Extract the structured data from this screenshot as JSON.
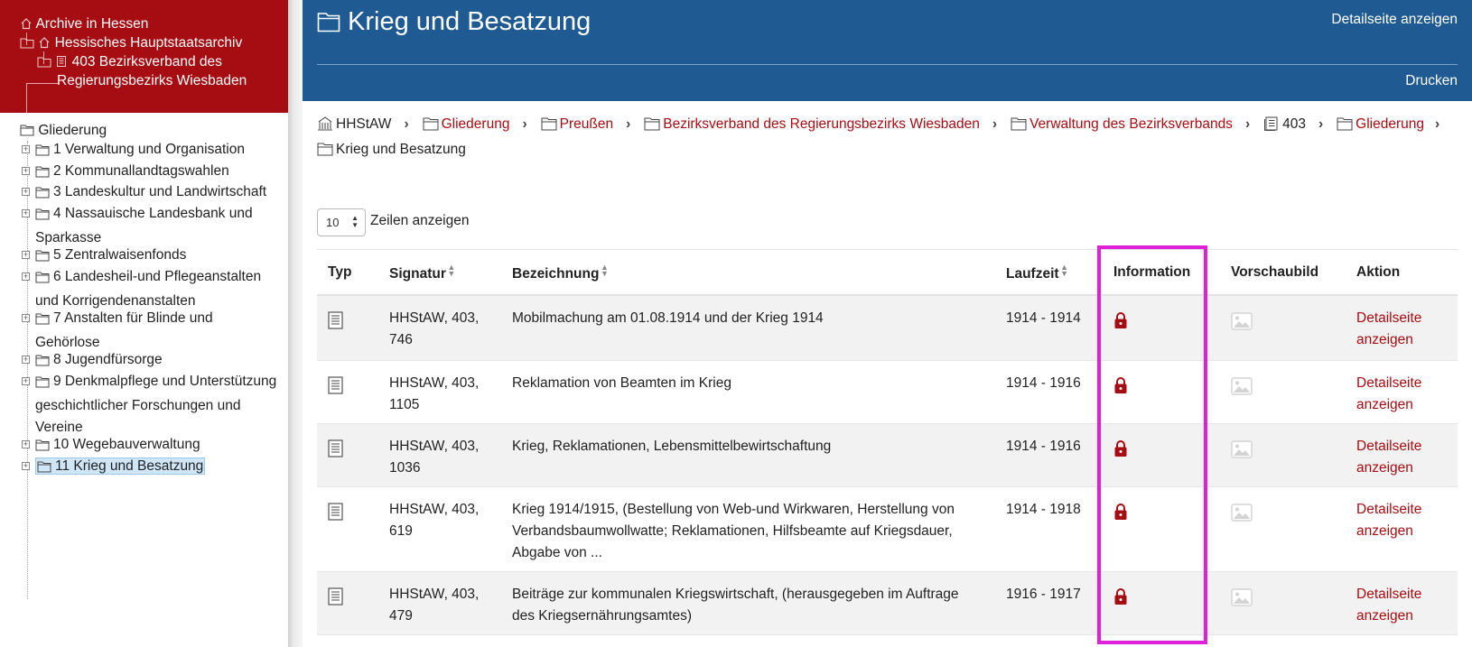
{
  "sidebar": {
    "top": {
      "archive": "Archive in Hessen",
      "haupt": "Hessisches Hauptstaatsarchiv",
      "bestand_line1": "403 Bezirksverband des",
      "bestand_line2": "Regierungsbezirks Wiesbaden"
    },
    "tree_root": "Gliederung",
    "tree_items": [
      {
        "label": "1 Verwaltung und Organisation"
      },
      {
        "label": "2 Kommunallandtagswahlen"
      },
      {
        "label": "3 Landeskultur und Landwirtschaft"
      },
      {
        "label": "4 Nassauische Landesbank und Sparkasse"
      },
      {
        "label": "5 Zentralwaisenfonds"
      },
      {
        "label": "6 Landesheil-und Pflegeanstalten und Korrigendenanstalten"
      },
      {
        "label": "7 Anstalten für Blinde und Gehörlose"
      },
      {
        "label": "8 Jugendfürsorge"
      },
      {
        "label": "9 Denkmalpflege und Unterstützung geschichtlicher Forschungen und Vereine"
      },
      {
        "label": "10 Wegebauverwaltung"
      },
      {
        "label": "11 Krieg und Besatzung"
      }
    ]
  },
  "header": {
    "title": "Krieg und Besatzung",
    "detail_link": "Detailseite anzeigen",
    "print_link": "Drucken"
  },
  "breadcrumb": [
    {
      "label": "HHStAW",
      "icon": "building-icon",
      "link": false
    },
    {
      "label": "Gliederung",
      "icon": "folder-icon",
      "link": true
    },
    {
      "label": "Preußen",
      "icon": "folder-icon",
      "link": true
    },
    {
      "label": "Bezirksverband des Regierungsbezirks Wiesbaden",
      "icon": "folder-icon",
      "link": true
    },
    {
      "label": "Verwaltung des Bezirksverbands",
      "icon": "folder-icon",
      "link": true
    },
    {
      "label": "403",
      "icon": "book-icon",
      "link": false
    },
    {
      "label": "Gliederung",
      "icon": "folder-icon",
      "link": true
    },
    {
      "label": "Krieg und Besatzung",
      "icon": "folder-icon",
      "link": false
    }
  ],
  "rows_select": {
    "value": "10",
    "label": "Zeilen anzeigen"
  },
  "table": {
    "headers": {
      "typ": "Typ",
      "signatur": "Signatur",
      "bezeichnung": "Bezeichnung",
      "laufzeit": "Laufzeit",
      "information": "Information",
      "vorschaubild": "Vorschaubild",
      "aktion": "Aktion"
    },
    "rows": [
      {
        "signatur": "HHStAW, 403, 746",
        "bezeichnung": "Mobilmachung am 01.08.1914 und der Krieg 1914",
        "laufzeit": "1914 - 1914",
        "aktion": "Detailseite anzeigen"
      },
      {
        "signatur": "HHStAW, 403, 1105",
        "bezeichnung": "Reklamation von Beamten im Krieg",
        "laufzeit": "1914 - 1916",
        "aktion": "Detailseite anzeigen"
      },
      {
        "signatur": "HHStAW, 403, 1036",
        "bezeichnung": "Krieg, Reklamationen, Lebensmittelbewirtschaftung",
        "laufzeit": "1914 - 1916",
        "aktion": "Detailseite anzeigen"
      },
      {
        "signatur": "HHStAW, 403, 619",
        "bezeichnung": "Krieg 1914/1915, (Bestellung von Web-und Wirkwaren, Herstellung von Verbandsbaumwollwatte; Reklamationen, Hilfsbeamte auf Kriegsdauer, Abgabe von ...",
        "laufzeit": "1914 - 1918",
        "aktion": "Detailseite anzeigen"
      },
      {
        "signatur": "HHStAW, 403, 479",
        "bezeichnung": "Beiträge zur kommunalen Kriegswirtschaft, (herausgegeben im Auftrage des Kriegsernährungsamtes)",
        "laufzeit": "1916 - 1917",
        "aktion": "Detailseite anzeigen"
      }
    ]
  },
  "colors": {
    "brand_red": "#a50d12",
    "header_blue": "#1f5a93",
    "highlight_magenta": "#e020d8",
    "selected_bg": "#cfe6f8"
  }
}
